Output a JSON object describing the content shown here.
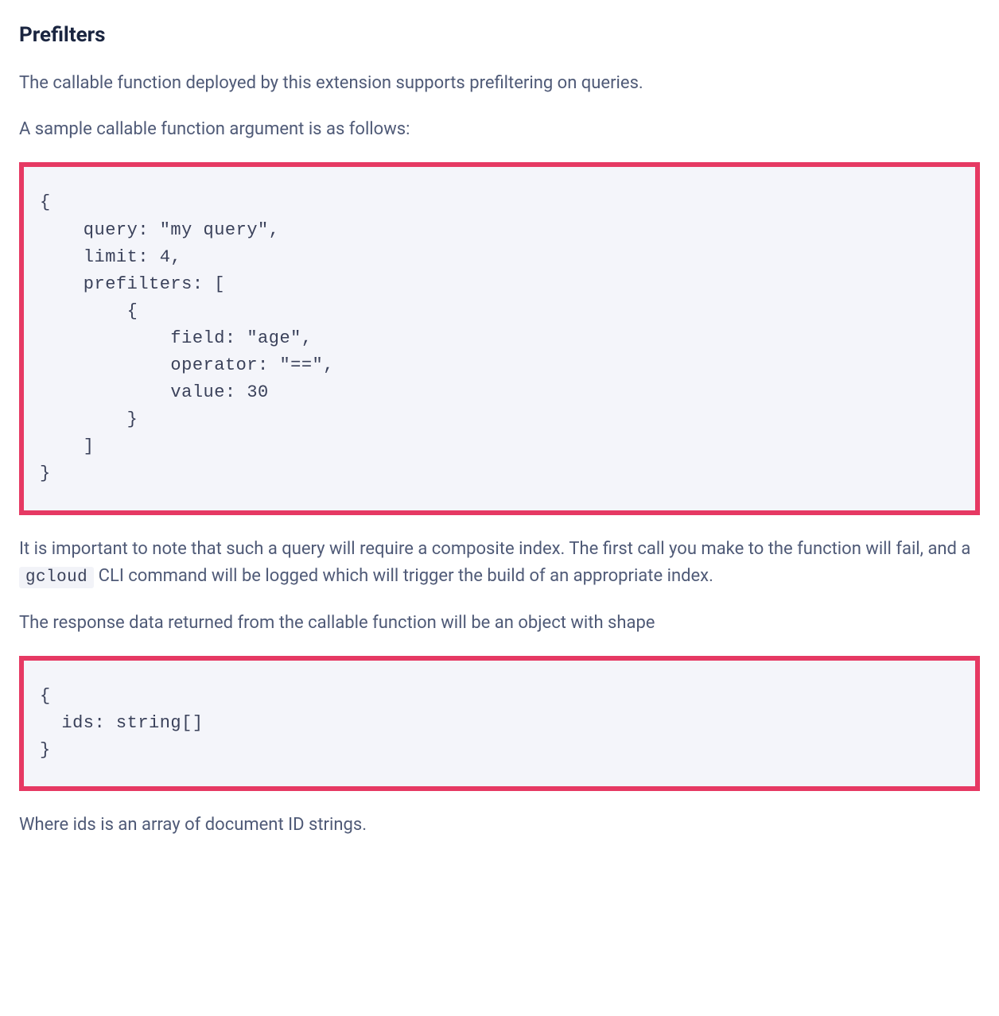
{
  "heading": "Prefilters",
  "p1": "The callable function deployed by this extension supports prefiltering on queries.",
  "p2": "A sample callable function argument is as follows:",
  "code1": "{\n    query: \"my query\",\n    limit: 4,\n    prefilters: [\n        {\n            field: \"age\",\n            operator: \"==\",\n            value: 30\n        }\n    ]\n}",
  "p3a": "It is important to note that such a query will require a composite index. The first call you make to the function will fail, and a ",
  "p3_code": "gcloud",
  "p3b": " CLI command will be logged which will trigger the build of an appropriate index.",
  "p4": "The response data returned from the callable function will be an object with shape",
  "code2": "{\n  ids: string[]\n}",
  "p5": "Where ids is an array of document ID strings."
}
